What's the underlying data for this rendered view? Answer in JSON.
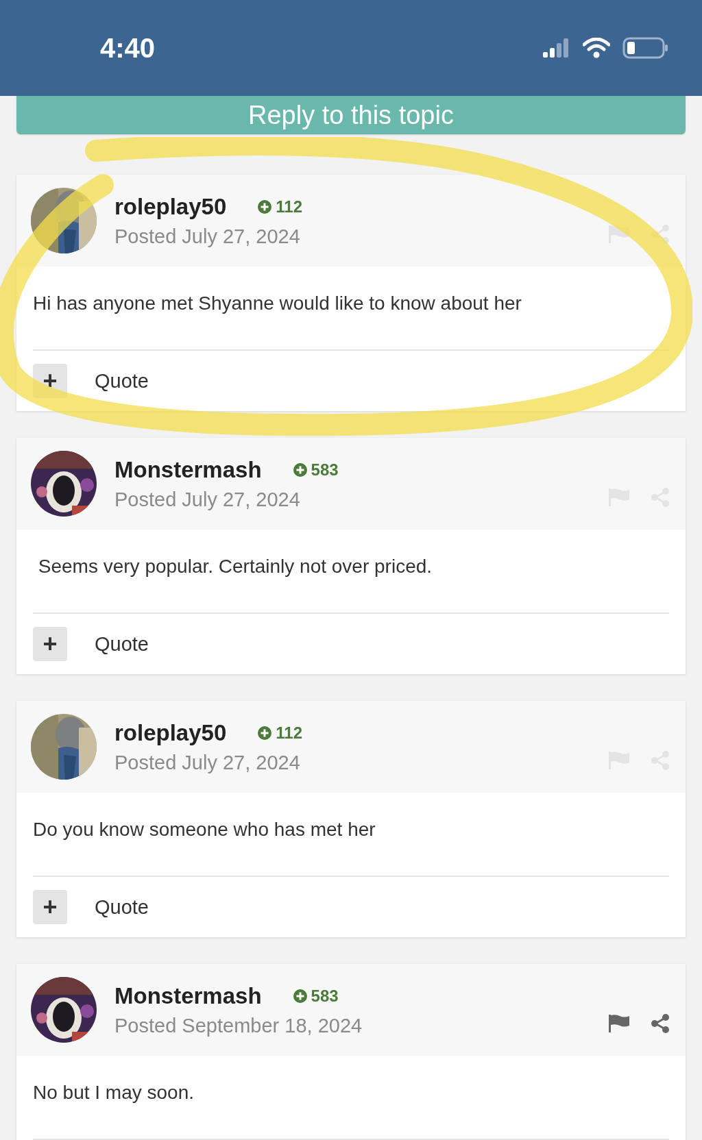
{
  "status_bar": {
    "time": "4:40"
  },
  "reply_button": {
    "label": "Reply to this topic"
  },
  "posts": [
    {
      "author": "roleplay50",
      "reputation": "112",
      "date": "Posted July 27, 2024",
      "body": "Hi has anyone met Shyanne would like to know about her",
      "actions_dim": true,
      "quote": "Quote",
      "plus": "+"
    },
    {
      "author": "Monstermash",
      "reputation": "583",
      "date": "Posted July 27, 2024",
      "body": " Seems very popular. Certainly not over priced.",
      "actions_dim": true,
      "quote": "Quote",
      "plus": "+"
    },
    {
      "author": "roleplay50",
      "reputation": "112",
      "date": "Posted July 27, 2024",
      "body": "Do you know someone who has met her",
      "actions_dim": true,
      "quote": "Quote",
      "plus": "+"
    },
    {
      "author": "Monstermash",
      "reputation": "583",
      "date": "Posted September 18, 2024",
      "body": "No but I may soon.",
      "actions_dim": false
    }
  ]
}
